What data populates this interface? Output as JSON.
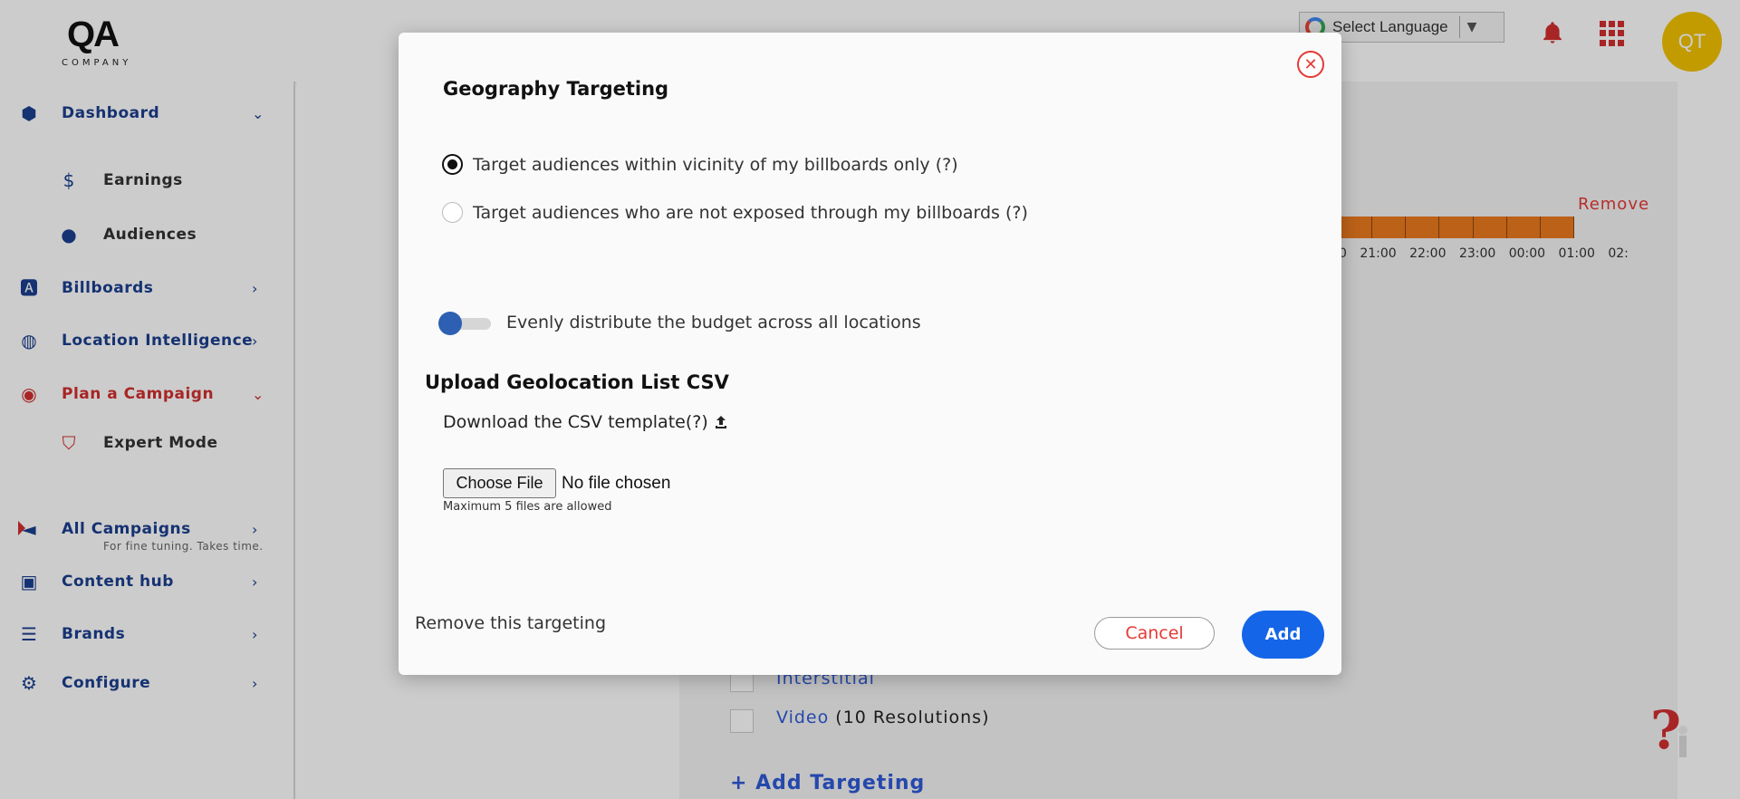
{
  "header": {
    "logo_mark": "QA",
    "logo_sub": "COMPANY",
    "language_label": "Select Language",
    "avatar_initials": "QT"
  },
  "sidebar": {
    "items": [
      {
        "label": "Dashboard"
      },
      {
        "label": "Earnings"
      },
      {
        "label": "Audiences"
      },
      {
        "label": "Billboards"
      },
      {
        "label": "Location Intelligence"
      },
      {
        "label": "Plan a Campaign"
      },
      {
        "label": "Expert Mode"
      },
      {
        "label": "All Campaigns"
      },
      {
        "label": "Content hub"
      },
      {
        "label": "Brands"
      },
      {
        "label": "Configure"
      }
    ],
    "expert_mode_subtitle": "For fine tuning. Takes time."
  },
  "background": {
    "remove_label": "Remove",
    "timeline_labels": "0 21:00 22:00 23:00 00:00 01:00 02:",
    "option_interstitial": "Interstitial",
    "option_video": "Video",
    "option_video_suffix": "(10 Resolutions)",
    "add_targeting": "+ Add Targeting"
  },
  "modal": {
    "title": "Geography Targeting",
    "radio_options": [
      {
        "label": "Target audiences within vicinity of my billboards only (?)",
        "checked": true
      },
      {
        "label": "Target audiences who are not exposed through my billboards (?)",
        "checked": false
      }
    ],
    "toggle_label": "Evenly distribute the budget across all locations",
    "toggle_on": false,
    "upload_section_title": "Upload Geolocation List CSV",
    "download_template": "Download the CSV template(?)",
    "choose_file_label": "Choose File",
    "file_status": "No file chosen",
    "file_hint": "Maximum 5 files are allowed",
    "remove_targeting": "Remove this targeting",
    "cancel_label": "Cancel",
    "add_label": "Add"
  },
  "colors": {
    "accent_blue": "#1565e8",
    "nav_blue": "#1b3f8f",
    "danger_red": "#e53935",
    "timeline_orange": "#ec7a1e",
    "avatar_gold": "#f2c200"
  }
}
